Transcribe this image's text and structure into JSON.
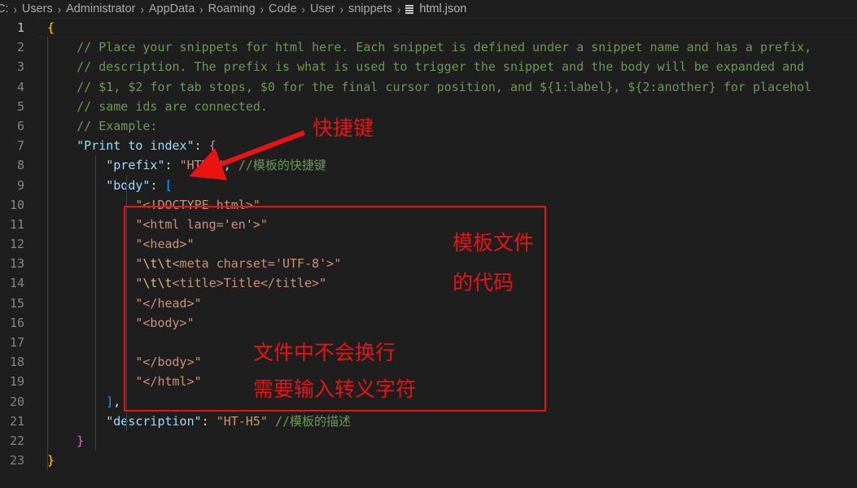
{
  "breadcrumb": {
    "segments": [
      "C:",
      "Users",
      "Administrator",
      "AppData",
      "Roaming",
      "Code",
      "User",
      "snippets"
    ],
    "separator": "›",
    "file_name": "html.json",
    "file_icon": "json-file-icon"
  },
  "editor": {
    "language": "json",
    "active_line": 1,
    "total_lines": 23,
    "colors": {
      "background": "#1e1e1e",
      "line_number": "#858585",
      "active_line_number": "#c6c6c6",
      "key": "#9cdcfe",
      "string": "#ce9178",
      "comment": "#6a9955",
      "escape": "#d7ba7d",
      "brace_yellow": "#ffd700",
      "brace_purple": "#da70d6",
      "bracket_blue": "#179fff",
      "annotation_red": "#ee1111"
    },
    "lines": [
      {
        "num": "1",
        "tokens": [
          {
            "t": "{",
            "c": "t-punct"
          }
        ]
      },
      {
        "num": "2",
        "tokens": [
          {
            "t": "    // Place your snippets for html here. Each snippet is defined under a snippet name and has a prefix,",
            "c": "t-cmt"
          }
        ]
      },
      {
        "num": "3",
        "tokens": [
          {
            "t": "    // description. The prefix is what is used to trigger the snippet and the body will be expanded and",
            "c": "t-cmt"
          }
        ]
      },
      {
        "num": "4",
        "tokens": [
          {
            "t": "    // $1, $2 for tab stops, $0 for the final cursor position, and ${1:label}, ${2:another} for placehol",
            "c": "t-cmt"
          }
        ]
      },
      {
        "num": "5",
        "tokens": [
          {
            "t": "    // same ids are connected.",
            "c": "t-cmt"
          }
        ]
      },
      {
        "num": "6",
        "tokens": [
          {
            "t": "    // Example:",
            "c": "t-cmt"
          }
        ]
      },
      {
        "num": "7",
        "tokens": [
          {
            "t": "    ",
            "c": "t-plain"
          },
          {
            "t": "\"Print to index\"",
            "c": "t-key"
          },
          {
            "t": ": ",
            "c": "t-plain"
          },
          {
            "t": "{",
            "c": "t-punct2"
          }
        ]
      },
      {
        "num": "8",
        "tokens": [
          {
            "t": "        ",
            "c": "t-plain"
          },
          {
            "t": "\"prefix\"",
            "c": "t-key"
          },
          {
            "t": ": ",
            "c": "t-plain"
          },
          {
            "t": "\"HTML\"",
            "c": "t-str"
          },
          {
            "t": ", ",
            "c": "t-plain"
          },
          {
            "t": "//模板的快捷键",
            "c": "t-cmt"
          }
        ]
      },
      {
        "num": "9",
        "tokens": [
          {
            "t": "        ",
            "c": "t-plain"
          },
          {
            "t": "\"body\"",
            "c": "t-key"
          },
          {
            "t": ": ",
            "c": "t-plain"
          },
          {
            "t": "[",
            "c": "t-punct3"
          }
        ]
      },
      {
        "num": "10",
        "tokens": [
          {
            "t": "            ",
            "c": "t-plain"
          },
          {
            "t": "\"<!DOCTYPE html>\"",
            "c": "t-str"
          }
        ]
      },
      {
        "num": "11",
        "tokens": [
          {
            "t": "            ",
            "c": "t-plain"
          },
          {
            "t": "\"<html lang='en'>\"",
            "c": "t-str"
          }
        ]
      },
      {
        "num": "12",
        "tokens": [
          {
            "t": "            ",
            "c": "t-plain"
          },
          {
            "t": "\"<head>\"",
            "c": "t-str"
          }
        ]
      },
      {
        "num": "13",
        "tokens": [
          {
            "t": "            ",
            "c": "t-plain"
          },
          {
            "t": "\"",
            "c": "t-str"
          },
          {
            "t": "\\t",
            "c": "t-esc"
          },
          {
            "t": "\\t",
            "c": "t-esc"
          },
          {
            "t": "<meta charset='UTF-8'>\"",
            "c": "t-str"
          }
        ]
      },
      {
        "num": "14",
        "tokens": [
          {
            "t": "            ",
            "c": "t-plain"
          },
          {
            "t": "\"",
            "c": "t-str"
          },
          {
            "t": "\\t",
            "c": "t-esc"
          },
          {
            "t": "\\t",
            "c": "t-esc"
          },
          {
            "t": "<title>Title</title>\"",
            "c": "t-str"
          }
        ]
      },
      {
        "num": "15",
        "tokens": [
          {
            "t": "            ",
            "c": "t-plain"
          },
          {
            "t": "\"</head>\"",
            "c": "t-str"
          }
        ]
      },
      {
        "num": "16",
        "tokens": [
          {
            "t": "            ",
            "c": "t-plain"
          },
          {
            "t": "\"<body>\"",
            "c": "t-str"
          }
        ]
      },
      {
        "num": "17",
        "tokens": [
          {
            "t": "",
            "c": "t-plain"
          }
        ]
      },
      {
        "num": "18",
        "tokens": [
          {
            "t": "            ",
            "c": "t-plain"
          },
          {
            "t": "\"</body>\"",
            "c": "t-str"
          }
        ]
      },
      {
        "num": "19",
        "tokens": [
          {
            "t": "            ",
            "c": "t-plain"
          },
          {
            "t": "\"</html>\"",
            "c": "t-str"
          }
        ]
      },
      {
        "num": "20",
        "tokens": [
          {
            "t": "        ",
            "c": "t-plain"
          },
          {
            "t": "]",
            "c": "t-punct3"
          },
          {
            "t": ",",
            "c": "t-plain"
          }
        ]
      },
      {
        "num": "21",
        "tokens": [
          {
            "t": "        ",
            "c": "t-plain"
          },
          {
            "t": "\"description\"",
            "c": "t-key"
          },
          {
            "t": ": ",
            "c": "t-plain"
          },
          {
            "t": "\"HT-H5\"",
            "c": "t-str"
          },
          {
            "t": " ",
            "c": "t-plain"
          },
          {
            "t": "//模板的描述",
            "c": "t-cmt"
          }
        ]
      },
      {
        "num": "22",
        "tokens": [
          {
            "t": "    ",
            "c": "t-plain"
          },
          {
            "t": "}",
            "c": "t-punct2"
          }
        ]
      },
      {
        "num": "23",
        "tokens": [
          {
            "t": "}",
            "c": "t-punct"
          }
        ]
      }
    ]
  },
  "annotations": {
    "shortcut_label": "快捷键",
    "template_code_label_line1": "模板文件",
    "template_code_label_line2": "的代码",
    "no_newline_label": "文件中不会换行",
    "escape_char_label": "需要输入转义字符"
  }
}
